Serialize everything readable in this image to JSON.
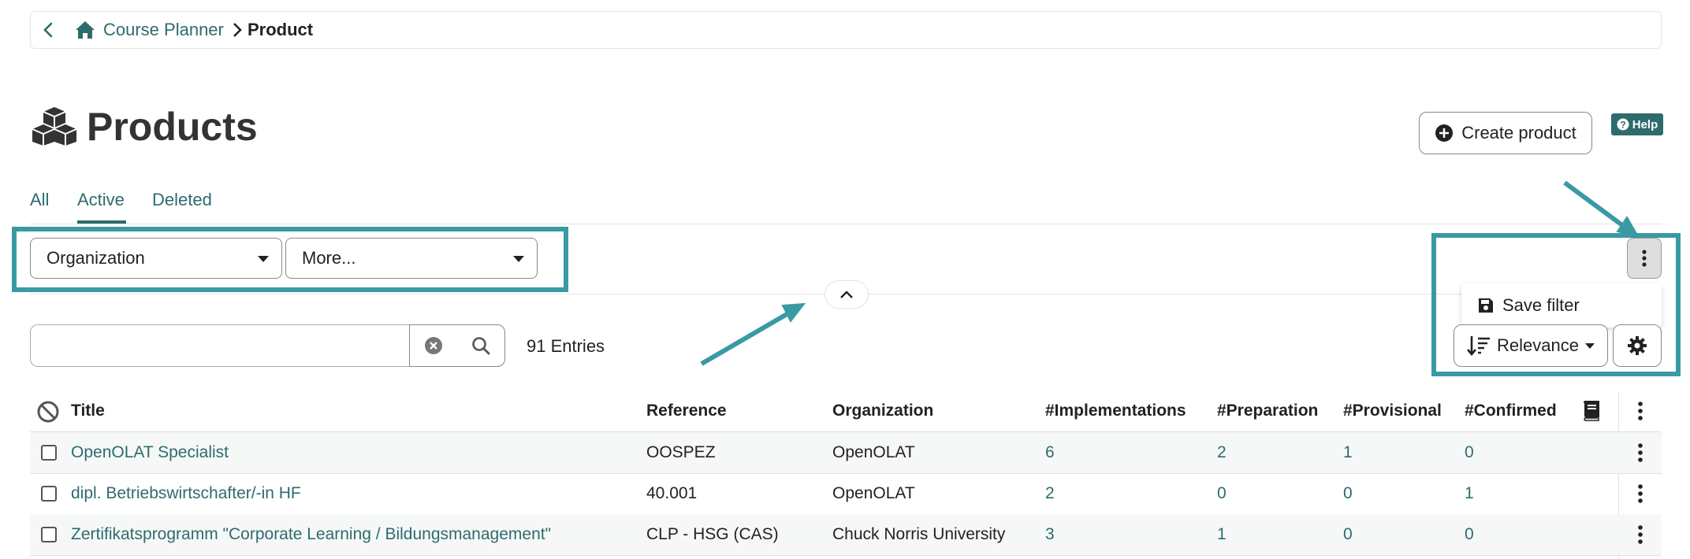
{
  "breadcrumb": {
    "home_link": "Course Planner",
    "current": "Product"
  },
  "page": {
    "title": "Products"
  },
  "actions": {
    "create_product": "Create product",
    "help": "Help"
  },
  "tabs": [
    {
      "label": "All",
      "active": false
    },
    {
      "label": "Active",
      "active": true
    },
    {
      "label": "Deleted",
      "active": false
    }
  ],
  "filters": {
    "organization": "Organization",
    "more": "More...",
    "save_filter": "Save filter"
  },
  "search": {
    "value": "",
    "entries": "91 Entries"
  },
  "sort": {
    "label": "Relevance"
  },
  "table": {
    "columns": [
      "Title",
      "Reference",
      "Organization",
      "#Implementations",
      "#Preparation",
      "#Provisional",
      "#Confirmed"
    ],
    "rows": [
      {
        "title": "OpenOLAT Specialist",
        "reference": "OOSPEZ",
        "organization": "OpenOLAT",
        "implementations": "6",
        "preparation": "2",
        "provisional": "1",
        "confirmed": "0"
      },
      {
        "title": "dipl. Betriebswirtschafter/-in HF",
        "reference": "40.001",
        "organization": "OpenOLAT",
        "implementations": "2",
        "preparation": "0",
        "provisional": "0",
        "confirmed": "1"
      },
      {
        "title": "Zertifikatsprogramm \"Corporate Learning / Bildungsmanagement\"",
        "reference": "CLP - HSG (CAS)",
        "organization": "Chuck Norris University",
        "implementations": "3",
        "preparation": "1",
        "provisional": "0",
        "confirmed": "0"
      }
    ]
  },
  "colors": {
    "accent": "#2e6b6d",
    "highlight": "#3a9aa4"
  },
  "icons": [
    "back-arrow-icon",
    "home-icon",
    "chevron-right-icon",
    "cubes-icon",
    "plus-circle-icon",
    "question-circle-icon",
    "chevron-up-icon",
    "kebab-icon",
    "save-icon",
    "clear-icon",
    "search-icon",
    "sort-icon",
    "gear-icon",
    "select-all-icon",
    "book-icon"
  ]
}
